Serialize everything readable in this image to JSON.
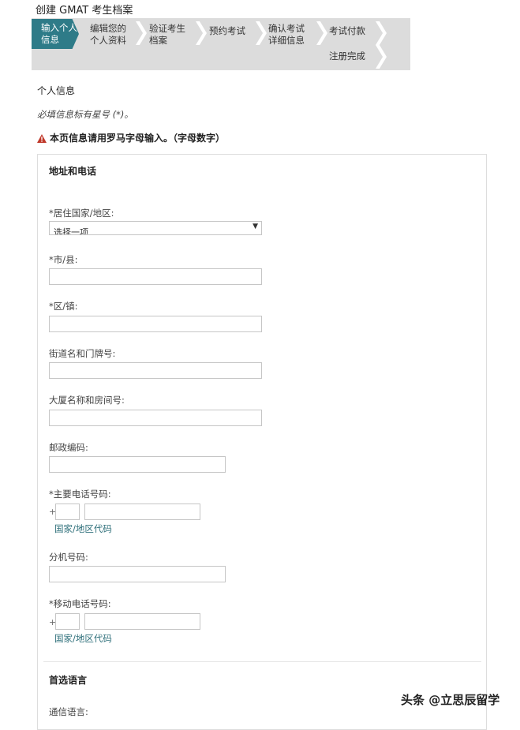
{
  "page": {
    "title": "创建 GMAT 考生档案"
  },
  "steps": [
    {
      "line1": "输入个人",
      "line2": "信息",
      "active": true
    },
    {
      "line1": "编辑您的",
      "line2": "个人资料",
      "active": false
    },
    {
      "line1": "验证考生",
      "line2": "档案",
      "active": false
    },
    {
      "line1": "预约考试",
      "line2": "",
      "active": false
    },
    {
      "line1": "确认考试",
      "line2": "详细信息",
      "active": false
    },
    {
      "line1": "考试付款",
      "line2": "",
      "active": false
    },
    {
      "line1": "注册完成",
      "line2": "",
      "active": false
    }
  ],
  "form": {
    "section_label": "个人信息",
    "required_note": "必填信息标有星号 (*)。",
    "warning_text": "本页信息请用罗马字母输入。（字母数字）",
    "address_title": "地址和电话",
    "fields": {
      "country_label": "*居住国家/地区:",
      "country_value": "选择一项",
      "city_label": "*市/县:",
      "district_label": "*区/镇:",
      "street_label": "街道名和门牌号:",
      "building_label": "大厦名称和房间号:",
      "postal_label": "邮政编码:",
      "phone_label": "*主要电话号码:",
      "phone_prefix": "+",
      "phone_country_code_label": "国家/地区代码",
      "extension_label": "分机号码:",
      "mobile_label": "*移动电话号码:",
      "mobile_prefix": "+",
      "mobile_country_code_label": "国家/地区代码"
    },
    "language_title": "首选语言",
    "comm_language_label": "通信语言:"
  },
  "watermark": "头条 @立思辰留学",
  "colors": {
    "active_step": "#2e7b88",
    "step_bar": "#dcdcdc",
    "warning_icon": "#c0392b",
    "link_text": "#2e6f7a"
  }
}
